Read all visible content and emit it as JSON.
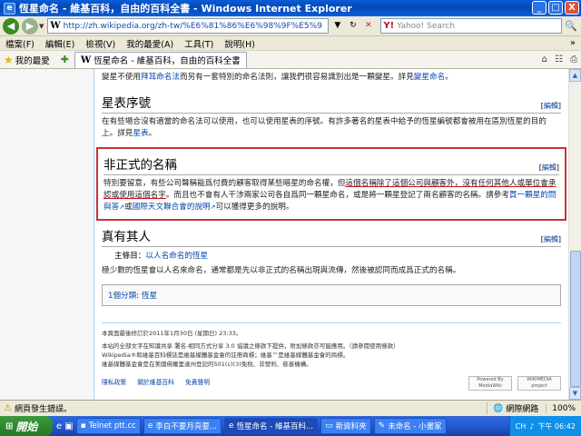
{
  "window": {
    "title": "恆星命名 - 維基百科，自由的百科全書 - Windows Internet Explorer",
    "buttons": {
      "minimize": "_",
      "maximize": "□",
      "close": "X"
    }
  },
  "address_bar": {
    "url": "http://zh.wikipedia.org/zh-tw/%E6%81%86%E6%98%9F%E5%9",
    "search_placeholder": "Yahoo! Search"
  },
  "menu": {
    "items": [
      "檔案(F)",
      "編輯(E)",
      "檢視(V)",
      "我的最愛(A)",
      "工具(T)",
      "說明(H)"
    ]
  },
  "favorites": {
    "label": "我的最愛",
    "tab_title": "恆星命名 - 維基百科，自由的百科全書"
  },
  "article": {
    "intro_pre": "變星不使用",
    "intro_link1": "拜耳命名法",
    "intro_mid": "而另有一套特別的命名法則，讓我們很容易識別出是一顆變星。詳見",
    "intro_link2": "變星命名",
    "intro_end": "。",
    "edit_label": "編輯",
    "sections": {
      "catalog": {
        "heading": "星表序號",
        "text_pre": "在有些場合沒有適當的命名法可以使用，也可以使用星表的序號。有許多著名的星表中給予的恆星編號都會被用在區別恆星的目的上。詳見",
        "text_link": "星表",
        "text_end": "。"
      },
      "informal": {
        "heading": "非正式的名稱",
        "text_a": "特別要留意，有些公司聲稱能爲付費的顧客取得某些暗星的命名權，但",
        "text_underlined": "這個名稱除了這個公司與顧客外，沒有任何其他人或單位會承認或使用這個名字",
        "text_b": "。而且也不會有人干涉兩家公司各自爲同一顆星命名，或是將一顆星登記了兩名顧客的名稱。請參考",
        "link1": "買一顆星的問與答",
        "text_c": "或",
        "link2": "國際天文聯合會的說明",
        "text_d": "可以獲得更多的說明。"
      },
      "real_people": {
        "heading": "真有其人",
        "hatnote_label": "主條目：",
        "hatnote_link": "以人名命名的恆星",
        "text": "極少數的恆星會以人名來命名，通常都是先以非正式的名稱出現與流傳，然後被認同而成爲正式的名稱。"
      }
    },
    "category": {
      "label": "1個分類",
      "separator": ": ",
      "link": "恆星"
    }
  },
  "footer": {
    "modified": "本頁面最後修訂於2011年1月30日 (星期日) 23:33。",
    "license": "本站的全部文字在知識共享 署名-相同方式分享 3.0 協議之條款下提供，附加條款亦可能應用。（請參閱使用條款）",
    "trademark": "Wikipedia®和維基百科標誌是維基媒體基金會的註冊商標；維基™是維基媒體基金會的商標。",
    "foundation": "維基媒體基金會是在美國佛羅里達州登記的501(c)(3)免稅、非營利、慈善機構。",
    "links": [
      "隱私政策",
      "關於維基百科",
      "免責聲明"
    ],
    "badge1": "Powered By MediaWiki",
    "badge2": "WIKIMEDIA project"
  },
  "status": {
    "text": "網頁發生錯誤。",
    "zone": "網際網路",
    "zoom": "100%"
  },
  "taskbar": {
    "start": "開始",
    "tasks": [
      "Telnet ptt.cc",
      "李白不要月亮要...",
      "恆星命名 - 維基百科...",
      "新資料夾",
      "未命名 - 小畫家"
    ],
    "lang": "CH",
    "clock": "下午 06:42"
  },
  "colors": {
    "titlebar": "#0a5ed8",
    "link": "#0645ad",
    "highlight_border": "#c8323a"
  }
}
